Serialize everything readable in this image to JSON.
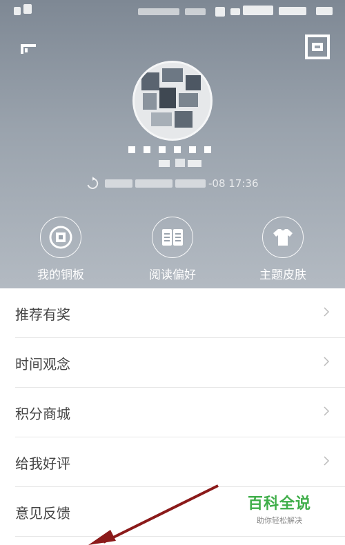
{
  "sync": {
    "time_fragment": "-08 17:36"
  },
  "features": [
    {
      "label": "我的铜板",
      "icon": "coin-icon"
    },
    {
      "label": "阅读偏好",
      "icon": "book-icon"
    },
    {
      "label": "主题皮肤",
      "icon": "shirt-icon"
    }
  ],
  "menu": [
    {
      "label": "推荐有奖"
    },
    {
      "label": "时间观念"
    },
    {
      "label": "积分商城"
    },
    {
      "label": "给我好评"
    },
    {
      "label": "意见反馈"
    }
  ],
  "watermark": {
    "title": "百科全说",
    "subtitle": "助你轻松解决"
  },
  "colors": {
    "header_top": "#7e8894",
    "header_bottom": "#b3bac2",
    "watermark_green": "#3fae49",
    "arrow_red": "#8b1a1a"
  }
}
